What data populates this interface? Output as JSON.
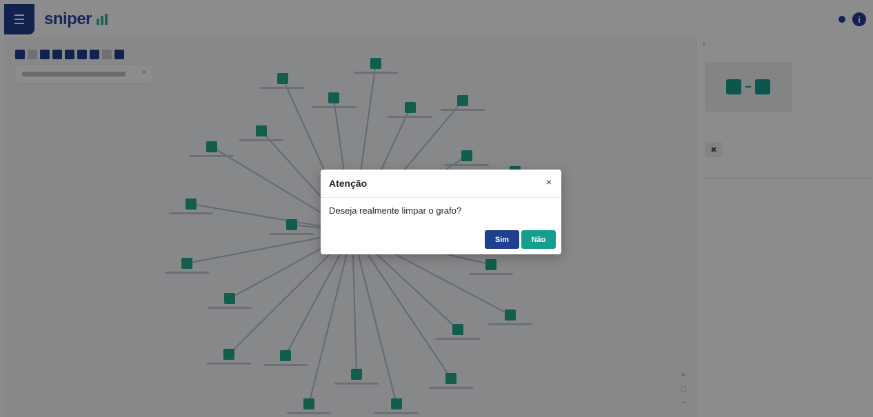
{
  "header": {
    "logo_text": "sniper",
    "menu_icon": "hamburger-menu-icon",
    "brand_color": "#1f3f8f",
    "accent_color": "#139e8e",
    "info_icon_glyph": "i"
  },
  "graph": {
    "search_clear_glyph": "×",
    "zoom_in_glyph": "+",
    "zoom_fit_glyph": "□",
    "zoom_out_glyph": "−",
    "node_count_visible": 25
  },
  "panel": {
    "close_glyph": "×",
    "preview_icon": "relation-preview-icon",
    "p_btn_glyph": "✖"
  },
  "modal": {
    "title": "Atenção",
    "close_glyph": "×",
    "message": "Deseja realmente limpar o grafo?",
    "yes_label": "Sim",
    "no_label": "Não"
  }
}
